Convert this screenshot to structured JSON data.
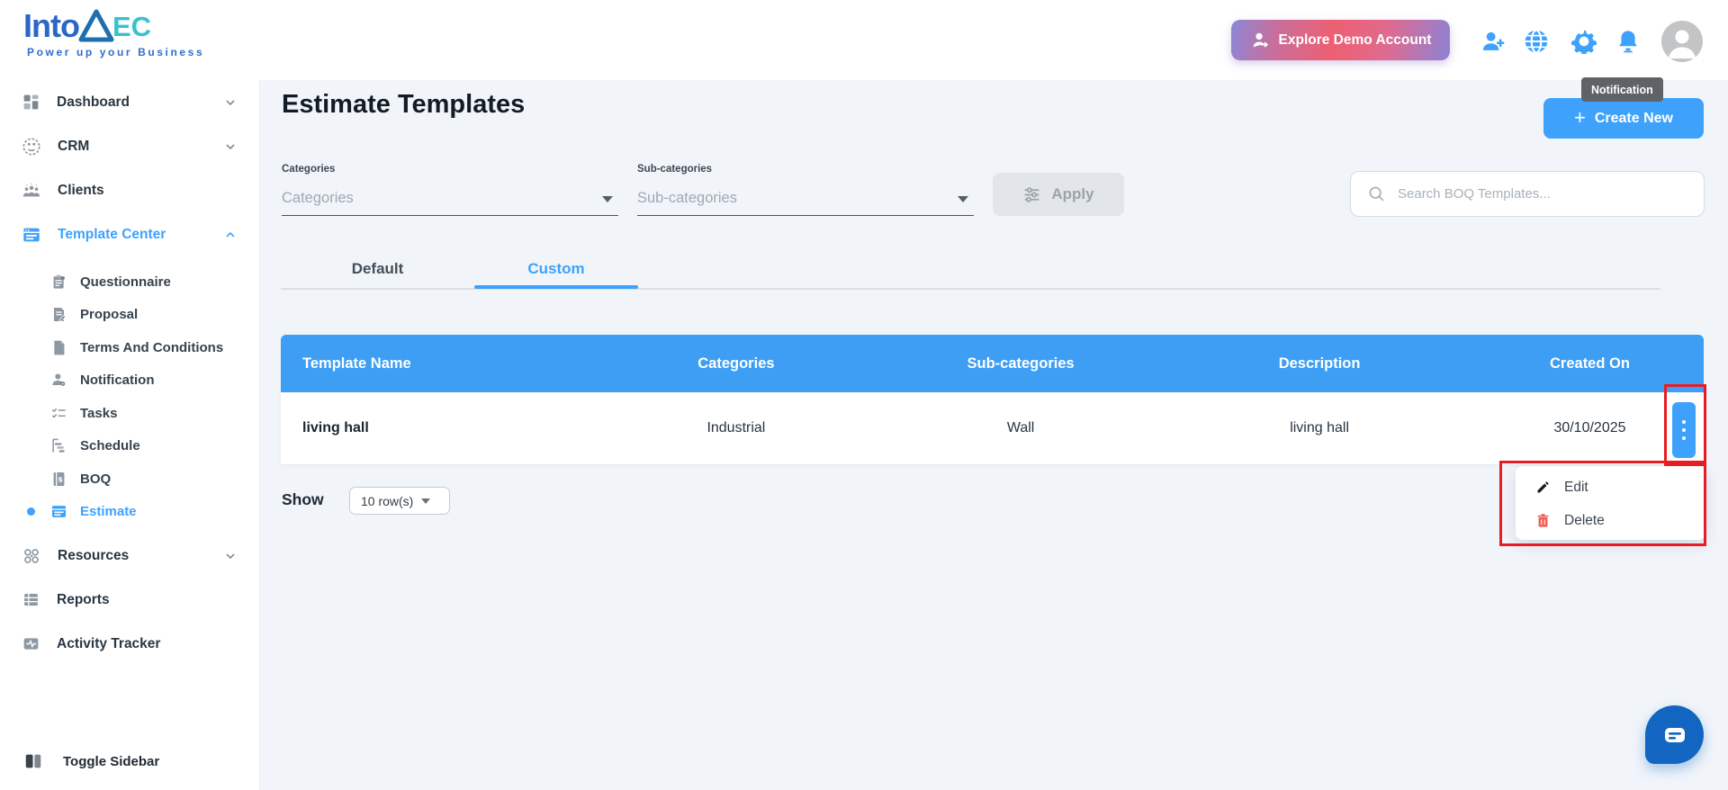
{
  "brand": {
    "logo_into": "Into",
    "logo_aec": "EC",
    "tagline": "Power up your Business"
  },
  "header": {
    "explore_button": "Explore Demo Account",
    "tooltip": "Notification"
  },
  "sidebar": {
    "items": [
      {
        "label": "Dashboard"
      },
      {
        "label": "CRM"
      },
      {
        "label": "Clients"
      },
      {
        "label": "Template Center"
      },
      {
        "label": "Questionnaire"
      },
      {
        "label": "Proposal"
      },
      {
        "label": "Terms And Conditions"
      },
      {
        "label": "Notification"
      },
      {
        "label": "Tasks"
      },
      {
        "label": "Schedule"
      },
      {
        "label": "BOQ"
      },
      {
        "label": "Estimate"
      },
      {
        "label": "Resources"
      },
      {
        "label": "Reports"
      },
      {
        "label": "Activity Tracker"
      }
    ],
    "toggle_label": "Toggle Sidebar"
  },
  "page": {
    "title": "Estimate Templates",
    "create_button": {
      "icon": "+",
      "label": "Create New"
    },
    "filters": {
      "categories_label": "Categories",
      "categories_placeholder": "Categories",
      "subcategories_label": "Sub-categories",
      "subcategories_placeholder": "Sub-categories",
      "apply_label": "Apply",
      "search_placeholder": "Search BOQ Templates..."
    },
    "tabs": [
      {
        "label": "Default"
      },
      {
        "label": "Custom"
      }
    ],
    "table": {
      "columns": [
        "Template Name",
        "Categories",
        "Sub-categories",
        "Description",
        "Created On"
      ],
      "rows": [
        [
          "living hall",
          "Industrial",
          "Wall",
          "living hall",
          "30/10/2025"
        ]
      ]
    },
    "row_menu": {
      "items": [
        {
          "label": "Edit"
        },
        {
          "label": "Delete"
        }
      ]
    },
    "pagination": {
      "show_label": "Show",
      "rows_value": "10 row(s)"
    }
  },
  "colors": {
    "primary_blue": "#3ea2fc",
    "table_header_blue": "#3d9ef3",
    "annotation_red": "#ea1c23",
    "delete_red": "#ee6055",
    "tooltip_bg": "#5f6368",
    "chat_blue": "#1266c2",
    "explore_gradient_mid": "#ee5f72",
    "explore_gradient_edge": "#8b87d8",
    "avatar_gray": "#c2c4c6"
  }
}
